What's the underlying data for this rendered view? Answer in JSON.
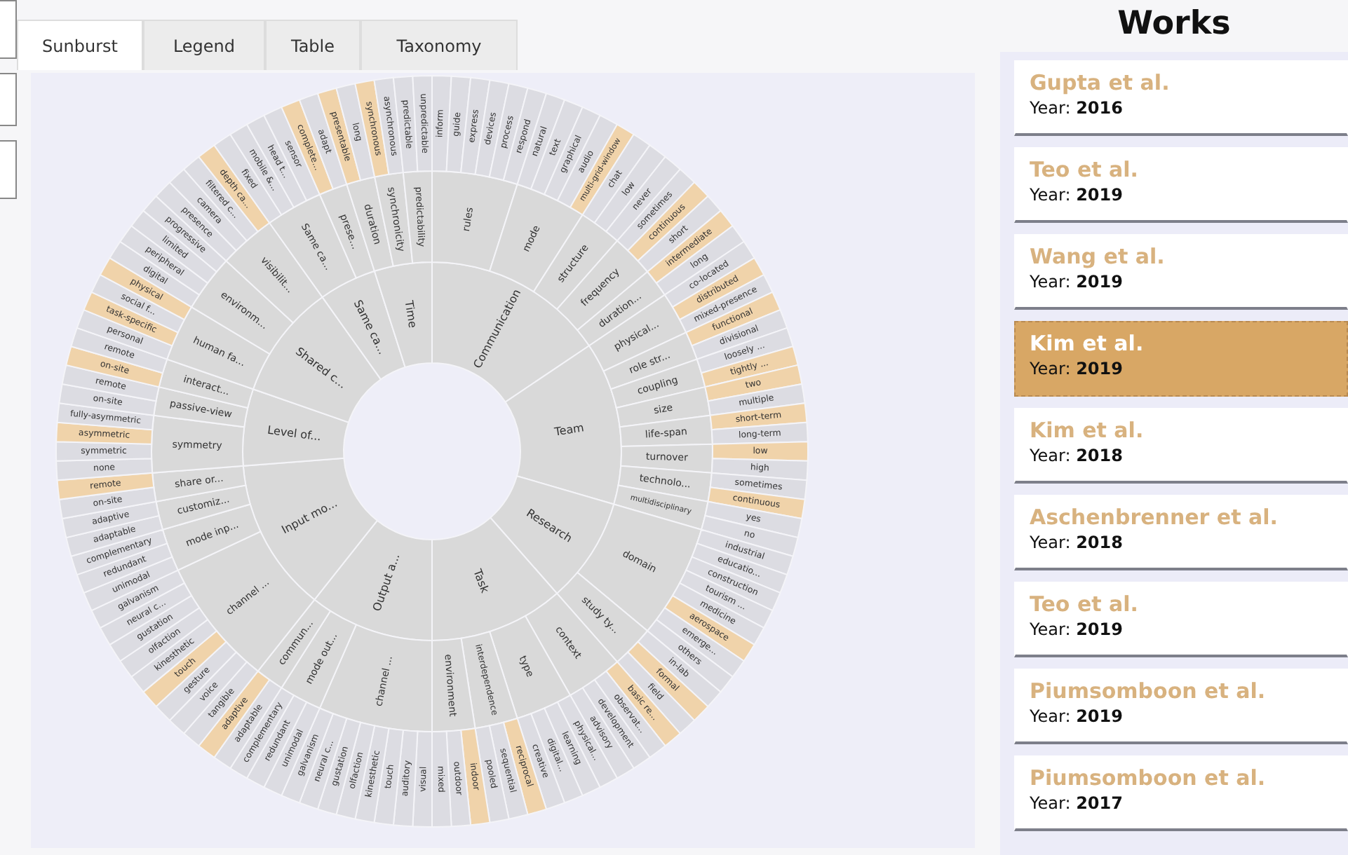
{
  "tabs": [
    {
      "label": "Sunburst",
      "selected": true
    },
    {
      "label": "Legend",
      "selected": false
    },
    {
      "label": "Table",
      "selected": false
    },
    {
      "label": "Taxonomy",
      "selected": false
    }
  ],
  "sunburst": {
    "children": [
      {
        "label": "Communication",
        "children": [
          {
            "label": "rules",
            "children": [
              {
                "label": "inform",
                "highlighted": false
              },
              {
                "label": "guide",
                "highlighted": false
              },
              {
                "label": "express",
                "highlighted": false
              },
              {
                "label": "devices",
                "highlighted": false
              },
              {
                "label": "process",
                "highlighted": false
              },
              {
                "label": "respond",
                "highlighted": false
              }
            ]
          },
          {
            "label": "mode",
            "children": [
              {
                "label": "natural",
                "highlighted": false
              },
              {
                "label": "text",
                "highlighted": false
              },
              {
                "label": "graphical",
                "highlighted": false
              },
              {
                "label": "audio",
                "highlighted": false
              },
              {
                "label": "multi-grid-window",
                "highlighted": true
              }
            ]
          },
          {
            "label": "structure",
            "children": [
              {
                "label": "chat",
                "highlighted": false
              },
              {
                "label": "low",
                "highlighted": false
              },
              {
                "label": "never",
                "highlighted": false
              }
            ]
          },
          {
            "label": "frequency",
            "children": [
              {
                "label": "sometimes",
                "highlighted": false
              },
              {
                "label": "continuous",
                "highlighted": true
              },
              {
                "label": "short",
                "highlighted": false
              }
            ]
          },
          {
            "label": "duration...",
            "children": [
              {
                "label": "intermediate",
                "highlighted": true
              },
              {
                "label": "long",
                "highlighted": false
              }
            ]
          }
        ]
      },
      {
        "label": "Team",
        "children": [
          {
            "label": "physical...",
            "children": [
              {
                "label": "co-located",
                "highlighted": false
              },
              {
                "label": "distributed",
                "highlighted": true
              },
              {
                "label": "mixed-presence",
                "highlighted": false
              }
            ]
          },
          {
            "label": "role str...",
            "children": [
              {
                "label": "functional",
                "highlighted": true
              },
              {
                "label": "divisional",
                "highlighted": false
              }
            ]
          },
          {
            "label": "coupling",
            "children": [
              {
                "label": "loosely ...",
                "highlighted": false
              },
              {
                "label": "tightly ...",
                "highlighted": true
              }
            ]
          },
          {
            "label": "size",
            "children": [
              {
                "label": "two",
                "highlighted": true
              },
              {
                "label": "multiple",
                "highlighted": false
              }
            ]
          },
          {
            "label": "life-span",
            "children": [
              {
                "label": "short-term",
                "highlighted": true
              },
              {
                "label": "long-term",
                "highlighted": false
              }
            ]
          },
          {
            "label": "turnover",
            "children": [
              {
                "label": "low",
                "highlighted": true
              },
              {
                "label": "high",
                "highlighted": false
              }
            ]
          },
          {
            "label": "technolo...",
            "children": [
              {
                "label": "sometimes",
                "highlighted": false
              },
              {
                "label": "continuous",
                "highlighted": true
              }
            ]
          },
          {
            "label": "multidisciplinary",
            "children": [
              {
                "label": "yes",
                "highlighted": false
              },
              {
                "label": "no",
                "highlighted": false
              }
            ]
          }
        ]
      },
      {
        "label": "Research",
        "children": [
          {
            "label": "domain",
            "children": [
              {
                "label": "industrial",
                "highlighted": false
              },
              {
                "label": "educatio...",
                "highlighted": false
              },
              {
                "label": "construction",
                "highlighted": false
              },
              {
                "label": "tourism ...",
                "highlighted": false
              },
              {
                "label": "medicine",
                "highlighted": false
              },
              {
                "label": "aerospace",
                "highlighted": true
              },
              {
                "label": "emerge...",
                "highlighted": false
              },
              {
                "label": "others",
                "highlighted": false
              }
            ]
          },
          {
            "label": "study ty...",
            "children": [
              {
                "label": "in-lab",
                "highlighted": false
              },
              {
                "label": "formal",
                "highlighted": true
              },
              {
                "label": "field",
                "highlighted": false
              }
            ]
          }
        ]
      },
      {
        "label": "Task",
        "children": [
          {
            "label": "context",
            "children": [
              {
                "label": "basic re...",
                "highlighted": true
              },
              {
                "label": "observat...",
                "highlighted": false
              },
              {
                "label": "development",
                "highlighted": false
              },
              {
                "label": "advisory",
                "highlighted": false
              }
            ]
          },
          {
            "label": "type",
            "children": [
              {
                "label": "physical...",
                "highlighted": false
              },
              {
                "label": "learning",
                "highlighted": false
              },
              {
                "label": "digital...",
                "highlighted": false
              },
              {
                "label": "creative",
                "highlighted": false
              }
            ]
          },
          {
            "label": "interdependence",
            "children": [
              {
                "label": "reciprocal",
                "highlighted": true
              },
              {
                "label": "sequential",
                "highlighted": false
              },
              {
                "label": "pooled",
                "highlighted": false
              }
            ]
          },
          {
            "label": "environment",
            "children": [
              {
                "label": "indoor",
                "highlighted": true
              },
              {
                "label": "outdoor",
                "highlighted": false
              },
              {
                "label": "mixed",
                "highlighted": false
              }
            ]
          }
        ]
      },
      {
        "label": "Output a...",
        "children": [
          {
            "label": "channel ...",
            "children": [
              {
                "label": "visual",
                "highlighted": false
              },
              {
                "label": "auditory",
                "highlighted": false
              },
              {
                "label": "touch",
                "highlighted": false
              },
              {
                "label": "kinesthetic",
                "highlighted": false
              },
              {
                "label": "olfaction",
                "highlighted": false
              },
              {
                "label": "gustation",
                "highlighted": false
              },
              {
                "label": "neural c...",
                "highlighted": false
              },
              {
                "label": "galvanism",
                "highlighted": false
              }
            ]
          },
          {
            "label": "mode out...",
            "children": [
              {
                "label": "unimodal",
                "highlighted": false
              },
              {
                "label": "redundant",
                "highlighted": false
              },
              {
                "label": "complementary",
                "highlighted": false
              }
            ]
          },
          {
            "label": "commun...",
            "children": [
              {
                "label": "adaptable",
                "highlighted": false
              },
              {
                "label": "adaptive",
                "highlighted": true
              }
            ]
          }
        ]
      },
      {
        "label": "Input mo...",
        "children": [
          {
            "label": "channel ...",
            "children": [
              {
                "label": "tangible",
                "highlighted": false
              },
              {
                "label": "voice",
                "highlighted": false
              },
              {
                "label": "gesture",
                "highlighted": false
              },
              {
                "label": "touch",
                "highlighted": true
              },
              {
                "label": "kinesthetic",
                "highlighted": false
              },
              {
                "label": "olfaction",
                "highlighted": false
              },
              {
                "label": "gustation",
                "highlighted": false
              },
              {
                "label": "neural c...",
                "highlighted": false
              },
              {
                "label": "galvanism",
                "highlighted": false
              }
            ]
          },
          {
            "label": "mode inp...",
            "children": [
              {
                "label": "unimodal",
                "highlighted": false
              },
              {
                "label": "redundant",
                "highlighted": false
              },
              {
                "label": "complementary",
                "highlighted": false
              }
            ]
          },
          {
            "label": "customiz...",
            "children": [
              {
                "label": "adaptable",
                "highlighted": false
              },
              {
                "label": "adaptive",
                "highlighted": false
              }
            ]
          },
          {
            "label": "share or...",
            "children": [
              {
                "label": "on-site",
                "highlighted": false
              },
              {
                "label": "remote",
                "highlighted": true
              }
            ]
          }
        ]
      },
      {
        "label": "Level of...",
        "children": [
          {
            "label": "symmetry",
            "children": [
              {
                "label": "none",
                "highlighted": false
              },
              {
                "label": "symmetric",
                "highlighted": false
              },
              {
                "label": "asymmetric",
                "highlighted": true
              },
              {
                "label": "fully-asymmetric",
                "highlighted": false
              }
            ]
          },
          {
            "label": "passive-view",
            "children": [
              {
                "label": "on-site",
                "highlighted": false
              },
              {
                "label": "remote",
                "highlighted": false
              }
            ]
          },
          {
            "label": "interact...",
            "children": [
              {
                "label": "on-site",
                "highlighted": true
              },
              {
                "label": "remote",
                "highlighted": false
              }
            ]
          }
        ]
      },
      {
        "label": "Shared c...",
        "children": [
          {
            "label": "human fa...",
            "children": [
              {
                "label": "personal",
                "highlighted": false
              },
              {
                "label": "task-specific",
                "highlighted": true
              },
              {
                "label": "social f...",
                "highlighted": false
              },
              {
                "label": "physical",
                "highlighted": true
              }
            ]
          },
          {
            "label": "environm...",
            "children": [
              {
                "label": "digital",
                "highlighted": false
              },
              {
                "label": "peripheral",
                "highlighted": false
              },
              {
                "label": "limited",
                "highlighted": false
              },
              {
                "label": "progressive",
                "highlighted": false
              }
            ]
          },
          {
            "label": "visibilit...",
            "children": [
              {
                "label": "presence",
                "highlighted": false
              },
              {
                "label": "camera",
                "highlighted": false
              },
              {
                "label": "filtered c...",
                "highlighted": false
              },
              {
                "label": "depth ca...",
                "highlighted": true
              }
            ]
          }
        ]
      },
      {
        "label": "Same ca...",
        "children": [
          {
            "label": "Same ca...",
            "children": [
              {
                "label": "fixed",
                "highlighted": false
              },
              {
                "label": "mobile &...",
                "highlighted": false
              },
              {
                "label": "head t...",
                "highlighted": false
              },
              {
                "label": "sensor",
                "highlighted": false
              }
            ]
          },
          {
            "label": "prese...",
            "children": [
              {
                "label": "complete...",
                "highlighted": true
              },
              {
                "label": "adapt",
                "highlighted": false
              }
            ]
          }
        ]
      },
      {
        "label": "Time",
        "children": [
          {
            "label": "duration",
            "children": [
              {
                "label": "presentable",
                "highlighted": true
              },
              {
                "label": "long",
                "highlighted": false
              }
            ]
          },
          {
            "label": "synchronicity",
            "children": [
              {
                "label": "synchronous",
                "highlighted": true
              },
              {
                "label": "asynchronous",
                "highlighted": false
              }
            ]
          },
          {
            "label": "predictability",
            "children": [
              {
                "label": "predictable",
                "highlighted": false
              },
              {
                "label": "unpredictable",
                "highlighted": false
              }
            ]
          }
        ]
      }
    ]
  },
  "works": {
    "title": "Works",
    "items": [
      {
        "author": "Gupta et al.",
        "year_label": "Year:",
        "year": "2016",
        "selected": false
      },
      {
        "author": "Teo et al.",
        "year_label": "Year:",
        "year": "2019",
        "selected": false
      },
      {
        "author": "Wang et al.",
        "year_label": "Year:",
        "year": "2019",
        "selected": false
      },
      {
        "author": "Kim et al.",
        "year_label": "Year:",
        "year": "2019",
        "selected": true
      },
      {
        "author": "Kim et al.",
        "year_label": "Year:",
        "year": "2018",
        "selected": false
      },
      {
        "author": "Aschenbrenner et al.",
        "year_label": "Year:",
        "year": "2018",
        "selected": false
      },
      {
        "author": "Teo et al.",
        "year_label": "Year:",
        "year": "2019",
        "selected": false
      },
      {
        "author": "Piumsomboon et al.",
        "year_label": "Year:",
        "year": "2019",
        "selected": false
      },
      {
        "author": "Piumsomboon et al.",
        "year_label": "Year:",
        "year": "2017",
        "selected": false
      }
    ]
  }
}
